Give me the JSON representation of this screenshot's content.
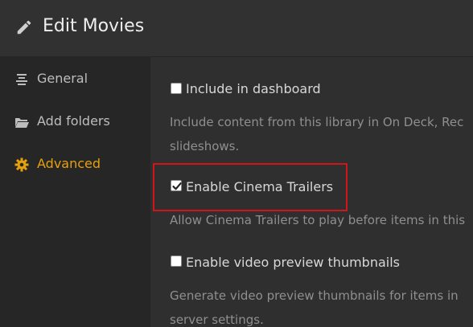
{
  "header": {
    "title": "Edit Movies",
    "icon": "pencil-icon"
  },
  "sidebar": {
    "items": [
      {
        "label": "General",
        "icon": "list-icon",
        "active": false
      },
      {
        "label": "Add folders",
        "icon": "folder-icon",
        "active": false
      },
      {
        "label": "Advanced",
        "icon": "gear-icon",
        "active": true
      }
    ]
  },
  "options": [
    {
      "label": "Include in dashboard",
      "checked": false,
      "description_lines": [
        "Include content from this library in On Deck, Rec",
        "slideshows."
      ]
    },
    {
      "label": "Enable Cinema Trailers",
      "checked": true,
      "description_lines": [
        "Allow Cinema Trailers to play before items in this"
      ]
    },
    {
      "label": "Enable video preview thumbnails",
      "checked": false,
      "description_lines": [
        "Generate video preview thumbnails for items in",
        "server settings."
      ]
    }
  ],
  "colors": {
    "accent": "#e5a00d",
    "highlight_border": "#d0161b",
    "background": "#2f2f2f",
    "sidebar": "#262626"
  }
}
